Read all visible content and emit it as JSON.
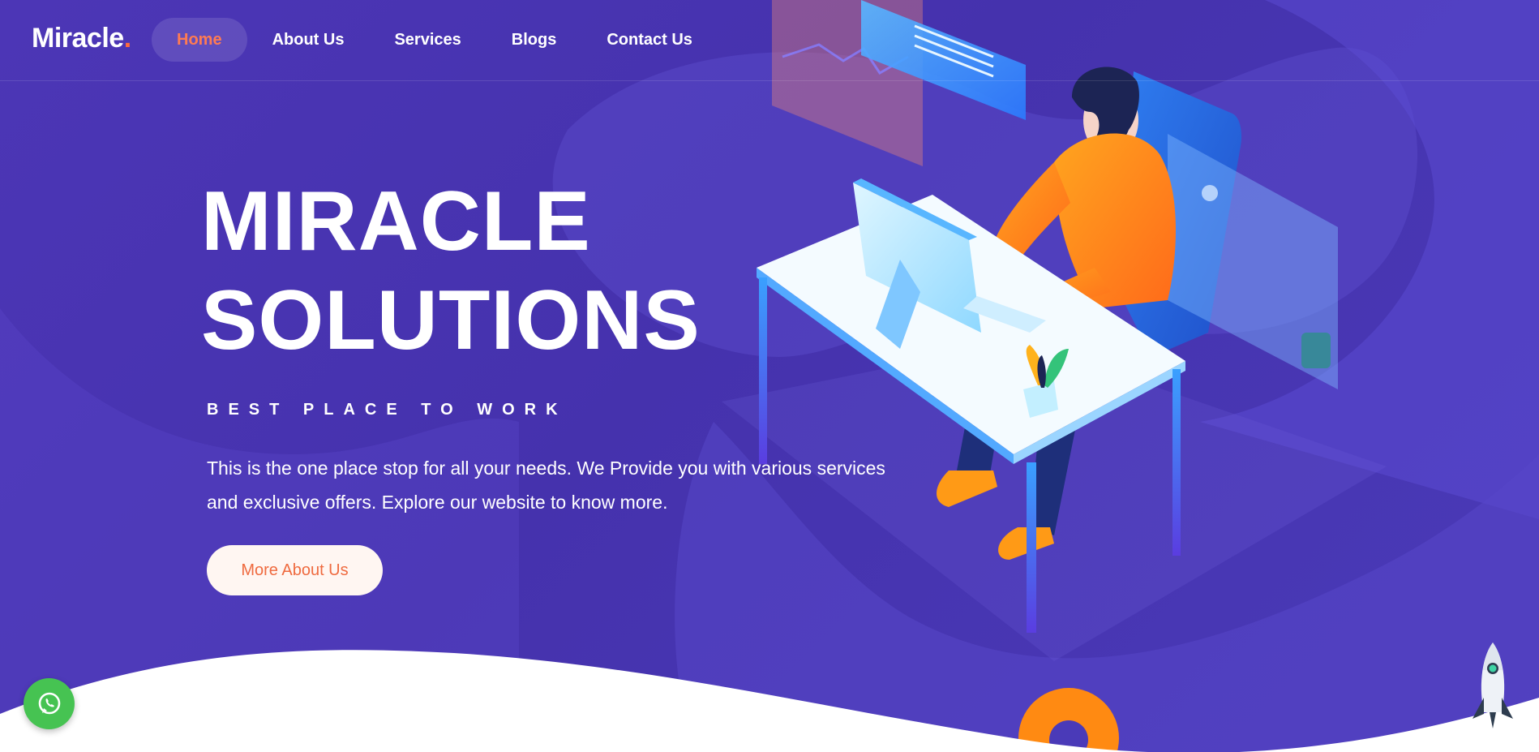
{
  "brand": {
    "name": "Miracle",
    "dot": "."
  },
  "nav": {
    "items": [
      {
        "label": "Home",
        "active": true
      },
      {
        "label": "About Us",
        "active": false
      },
      {
        "label": "Services",
        "active": false
      },
      {
        "label": "Blogs",
        "active": false
      },
      {
        "label": "Contact Us",
        "active": false
      }
    ]
  },
  "hero": {
    "title_line1": "MIRACLE",
    "title_line2": "SOLUTIONS",
    "tagline": "BEST PLACE TO WORK",
    "description": "This is the one place stop for all your needs. We Provide you with various services and exclusive offers. Explore our website to know more.",
    "cta_label": "More About Us"
  },
  "floating": {
    "whatsapp_icon": "whatsapp-icon",
    "scroll_top_icon": "rocket-icon"
  },
  "colors": {
    "background": "#4a35b3",
    "accent": "#ff6b3d",
    "cta_bg": "#fff6f2",
    "cta_text": "#ef6a3f",
    "whatsapp": "#46c352"
  }
}
